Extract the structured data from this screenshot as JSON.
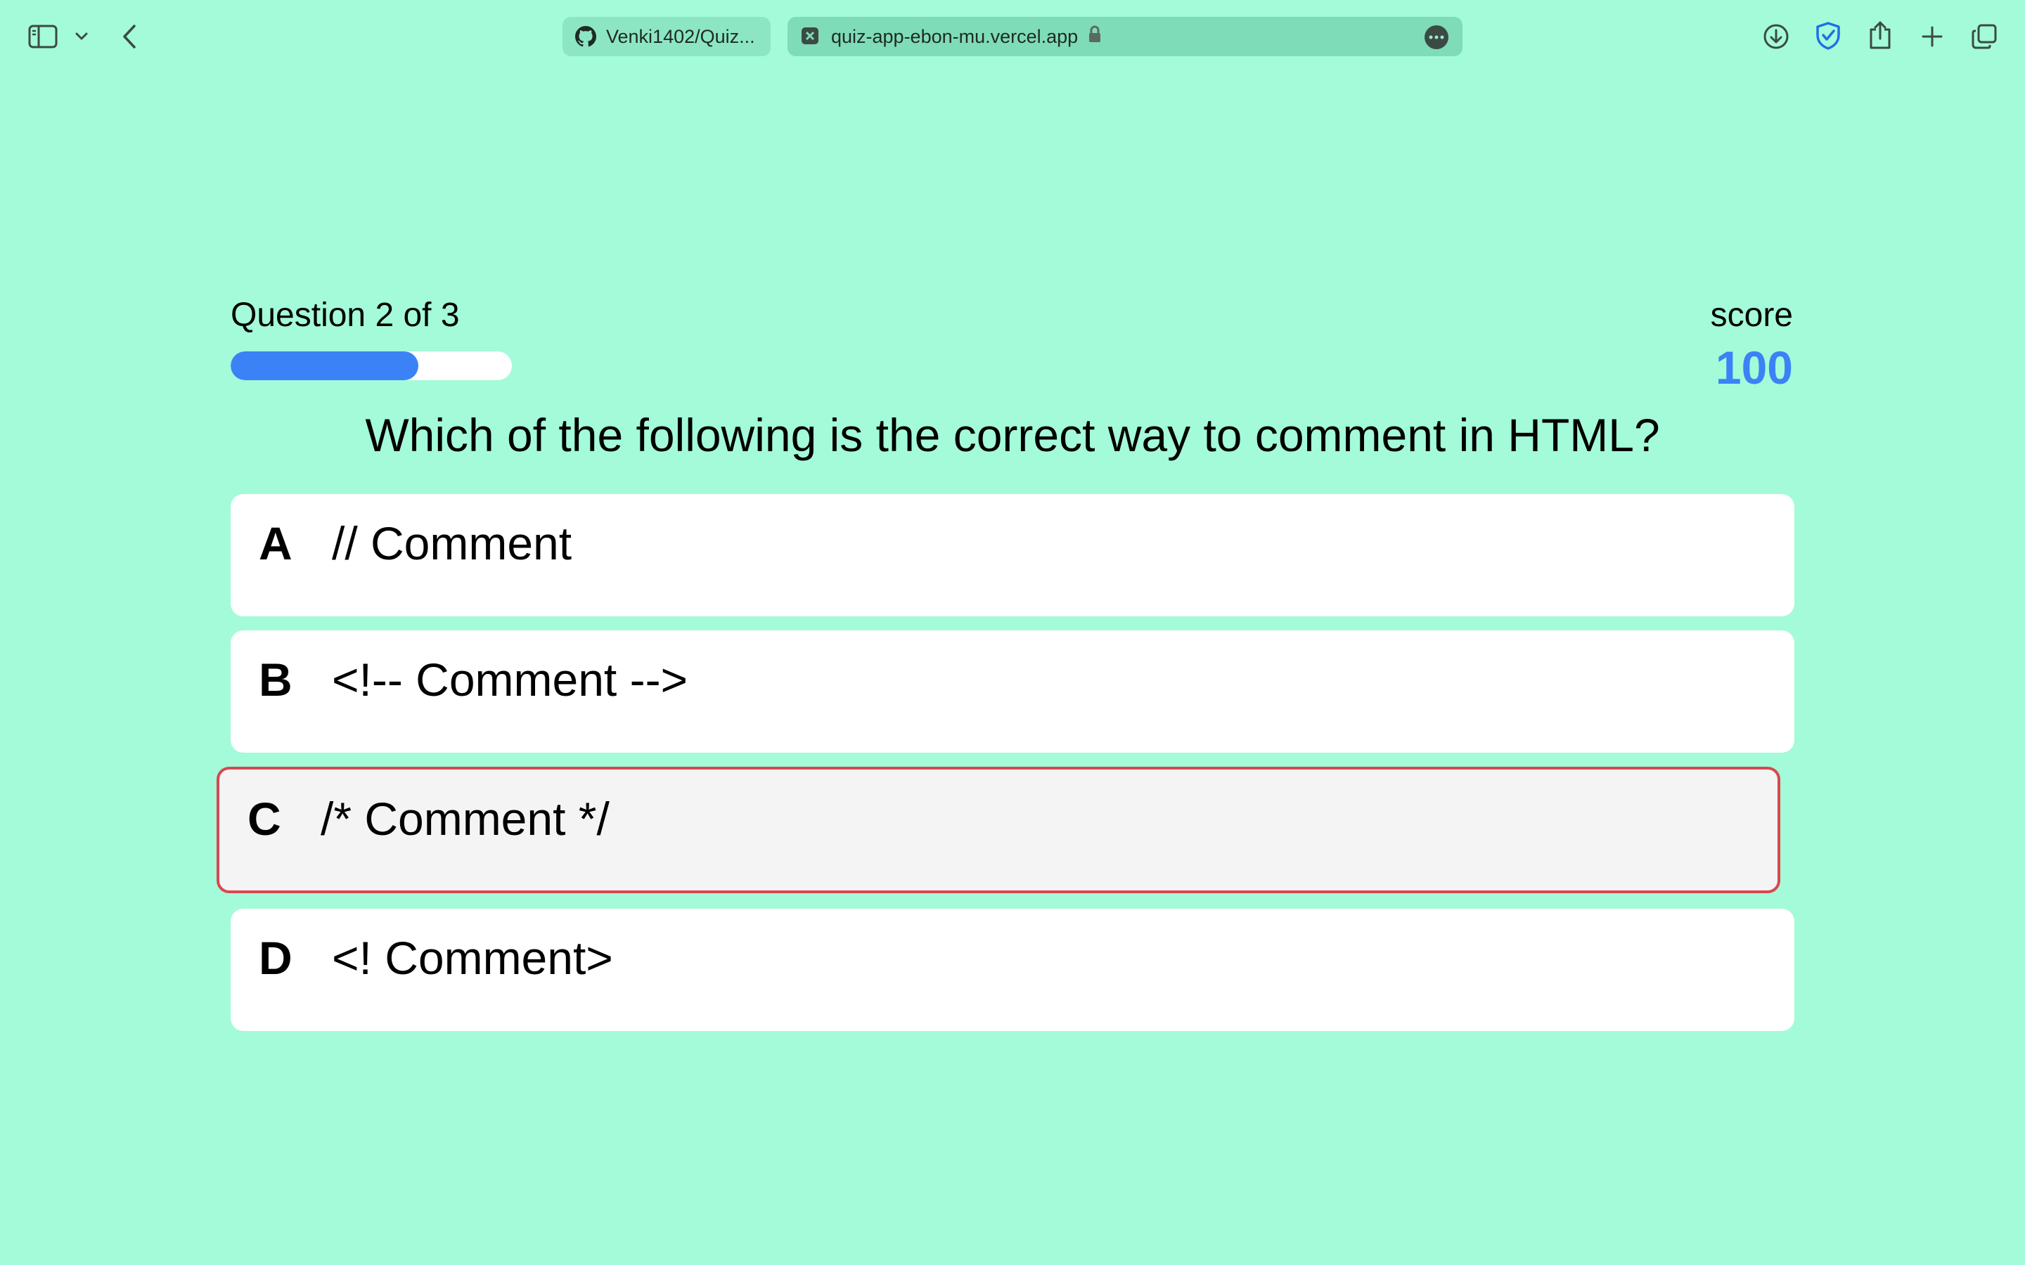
{
  "browser": {
    "tabs": [
      {
        "label": "Venki1402/Quiz...",
        "icon": "github-icon"
      },
      {
        "label": "quiz-app-ebon-mu.vercel.app",
        "icon": "favicon-x-icon",
        "secure": true
      }
    ],
    "toolbar_icons": [
      "sidebar-icon",
      "chevron-down-icon",
      "back-icon",
      "download-icon",
      "shield-icon",
      "share-icon",
      "plus-icon",
      "tabs-overview-icon"
    ]
  },
  "quiz": {
    "progress_label": "Question 2 of 3",
    "progress_fraction": 0.667,
    "score_label": "score",
    "score_value": "100",
    "question": "Which of the following is the correct way to comment in HTML?",
    "options": [
      {
        "letter": "A",
        "text": "// Comment"
      },
      {
        "letter": "B",
        "text": "<!-- Comment -->"
      },
      {
        "letter": "C",
        "text": "/* Comment */",
        "selected": true,
        "state": "incorrect"
      },
      {
        "letter": "D",
        "text": "<! Comment>"
      }
    ]
  },
  "colors": {
    "background": "#a3fbd9",
    "accent": "#3b82f6",
    "selected_border": "#d9474f",
    "selected_background": "#f4f4f4"
  }
}
